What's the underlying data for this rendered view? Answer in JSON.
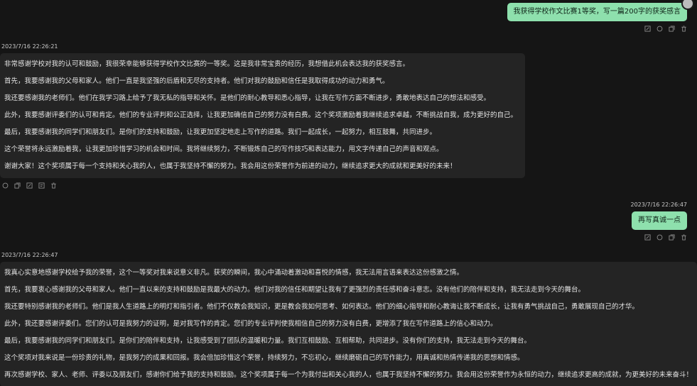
{
  "user_message_1": {
    "text": "我获得学校作文比赛1等奖，写一篇200字的获奖感言"
  },
  "bot_message_1": {
    "time": "2023/7/16 22:26:21",
    "paragraphs": [
      "非常感谢学校对我的认可和鼓励，我很荣幸能够获得学校作文比赛的一等奖。这是我非常宝贵的经历，我想借此机会表达我的获奖感言。",
      "首先，我要感谢我的父母和家人。他们一直是我坚强的后盾和无尽的支持者。他们对我的鼓励和信任是我取得成功的动力和勇气。",
      "我还要感谢我的老师们。他们在我学习路上给予了我无私的指导和关怀。是他们的耐心教导和悉心指导，让我在写作方面不断进步，勇敢地表达自己的想法和感受。",
      "此外，我要感谢评委们的认可和肯定。他们的专业评判和公正选择，让我更加确信自己的努力没有白费。这个奖项激励着我继续追求卓越，不断挑战自我，成为更好的自己。",
      "最后，我要感谢我的同学们和朋友们。是你们的支持和鼓励，让我更加坚定地走上写作的道路。我们一起成长，一起努力，相互鼓舞，共同进步。",
      "这个荣誉将永远激励着我，让我更加珍惜学习的机会和时间。我将继续努力，不断锻炼自己的写作技巧和表达能力，用文字传递自己的声音和观点。",
      "谢谢大家！这个奖项属于每一个支持和关心我的人，也属于我坚持不懈的努力。我会用这份荣誉作为前进的动力，继续追求更大的成就和更美好的未来！"
    ]
  },
  "user_message_2": {
    "time": "2023/7/16 22:26:47",
    "text": "再写真诚一点"
  },
  "bot_message_2": {
    "time": "2023/7/16 22:26:47",
    "paragraphs": [
      "我真心实意地感谢学校给予我的荣誉，这个一等奖对我来说意义非凡。获奖的瞬间，我心中涌动着激动和喜悦的情感，我无法用言语来表达这份感激之情。",
      "首先，我要衷心感谢我的父母和家人。他们一直以来的支持和鼓励是我最大的动力。他们对我的信任和期望让我有了更强烈的责任感和奋斗意志。没有他们的陪伴和支持，我无法走到今天的舞台。",
      "我还要特别感谢我的老师们。他们是我人生道路上的明灯和指引者。他们不仅教会我知识，更是教会我如何思考、如何表达。他们的细心指导和耐心教诲让我不断成长，让我有勇气挑战自己，勇敢展现自己的才华。",
      "此外，我还要感谢评委们。您们的认可是我努力的证明，是对我写作的肯定。您们的专业评判使我相信自己的努力没有白费，更增添了我在写作道路上的信心和动力。",
      "最后，我要感谢我的同学们和朋友们。是你们的陪伴和支持，让我感受到了团队的温暖和力量。我们互相鼓励、互相帮助，共同进步。没有你们的支持，我无法走到今天的舞台。",
      "这个奖项对我来说是一份珍贵的礼物，是我努力的成果和回报。我会倍加珍惜这个荣誉，持续努力，不忘初心，继续磨砺自己的写作能力，用真诚和热情传递我的思想和情感。",
      "再次感谢学校、家人、老师、评委以及朋友们，感谢你们给予我的支持和鼓励。这个奖项属于每一个为我付出和关心我的人，也属于我坚持不懈的努力。我会用这份荣誉作为永恒的动力，继续追求更高的成就，为更美好的未来奋斗！"
    ]
  },
  "icons": {
    "user_actions": [
      "edit-icon",
      "copy-icon",
      "refresh-icon",
      "delete-icon"
    ],
    "bot_actions": [
      "copy-icon",
      "refresh-icon",
      "edit-icon",
      "share-icon",
      "delete-icon"
    ]
  },
  "colors": {
    "background": "#151515",
    "user_bubble": "#8ee0ad",
    "bot_bubble": "#242424"
  }
}
